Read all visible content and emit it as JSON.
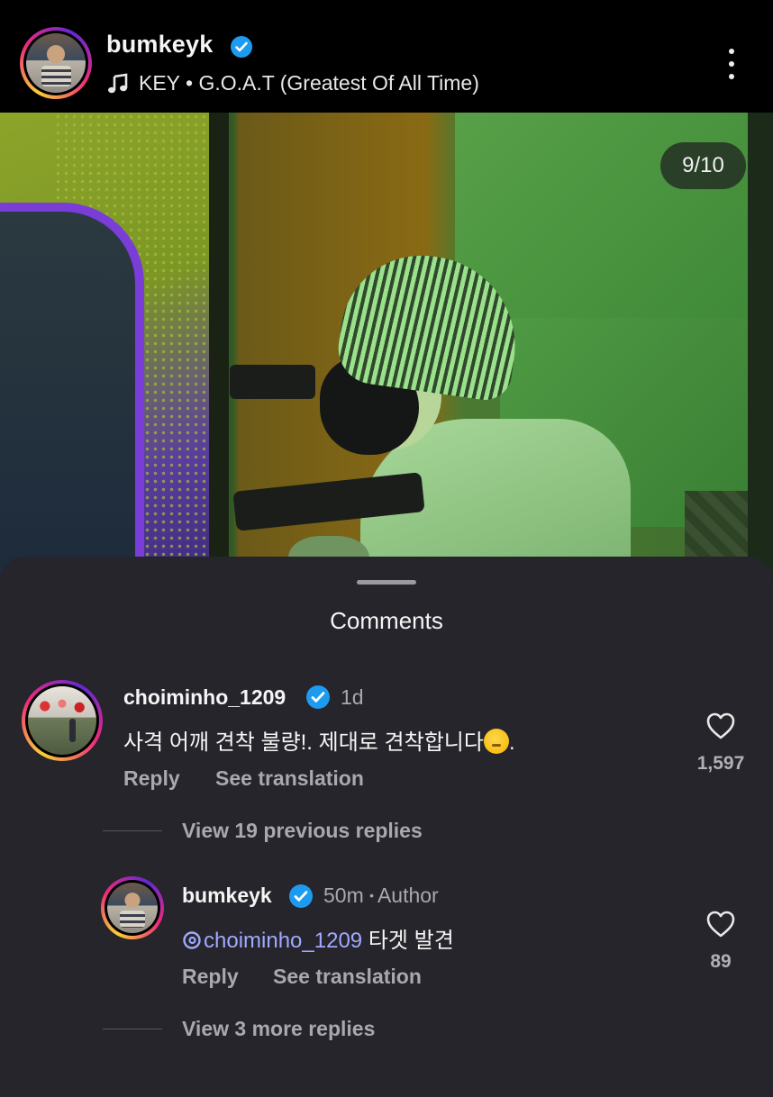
{
  "header": {
    "username": "bumkeyk",
    "music": "KEY • G.O.A.T (Greatest Of All Time)"
  },
  "post": {
    "image_counter": "9/10"
  },
  "comments_sheet": {
    "title": "Comments",
    "comments": [
      {
        "username": "choiminho_1209",
        "time": "1d",
        "text": "사격 어깨 견착 불량!. 제대로 견착합니다",
        "text_suffix": ".",
        "likes": "1,597",
        "reply_label": "Reply",
        "translate_label": "See translation",
        "view_replies": "View 19 previous replies"
      },
      {
        "username": "bumkeyk",
        "time": "50m",
        "author_label": "Author",
        "mention": "@choiminho_1209",
        "text": "타겟 발견",
        "likes": "89",
        "reply_label": "Reply",
        "translate_label": "See translation",
        "view_replies": "View 3 more replies"
      }
    ]
  },
  "colors": {
    "background": "#000000",
    "sheet": "#25252b",
    "verified": "#1d9bf0",
    "mention": "#a0a9ff"
  },
  "icons": [
    "verified-badge-icon",
    "music-note-icon",
    "more-options-icon",
    "heart-icon",
    "threads-icon"
  ]
}
